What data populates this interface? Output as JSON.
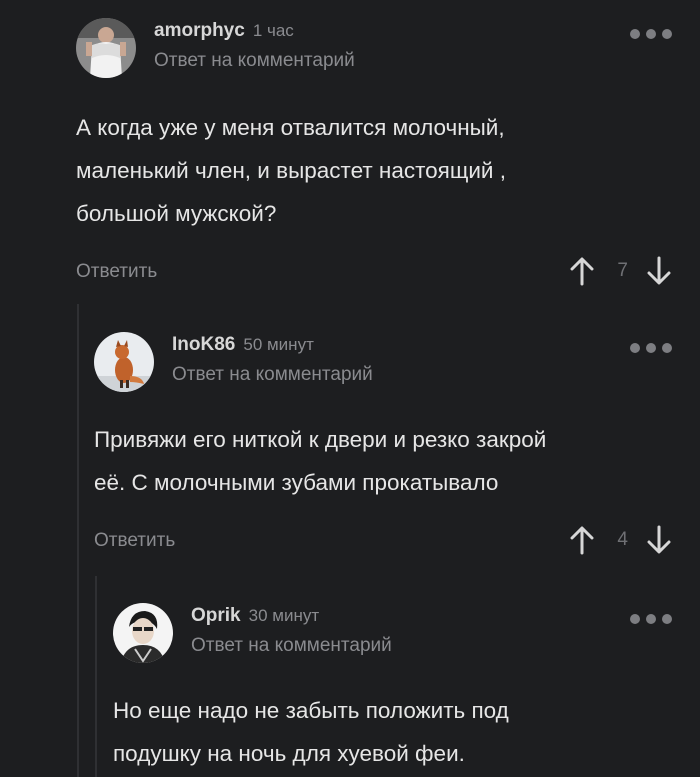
{
  "comments": [
    {
      "author": "amorphyc",
      "time": "1 час",
      "reply_to": "Ответ на комментарий",
      "text_lines": [
        "А когда уже у меня отвалится молочный,",
        "маленький член, и вырастет настоящий ,",
        "большой мужской?"
      ],
      "reply_label": "Ответить",
      "score": "7"
    },
    {
      "author": "InoK86",
      "time": "50 минут",
      "reply_to": "Ответ на комментарий",
      "text_lines": [
        "Привяжи его ниткой к двери и резко закрой",
        "её. С молочными зубами прокатывало"
      ],
      "reply_label": "Ответить",
      "score": "4"
    },
    {
      "author": "Oprik",
      "time": "30 минут",
      "reply_to": "Ответ на комментарий",
      "text_lines": [
        "Но еще надо не забыть положить под",
        "подушку на ночь для хуевой феи."
      ]
    }
  ],
  "icons": {
    "more": "more-dots-icon",
    "upvote": "arrow-up-icon",
    "downvote": "arrow-down-icon"
  },
  "colors": {
    "background": "#1d1e20",
    "text": "#e6e6e6",
    "muted": "#8a8b8f",
    "thread_line": "#2f3033"
  }
}
